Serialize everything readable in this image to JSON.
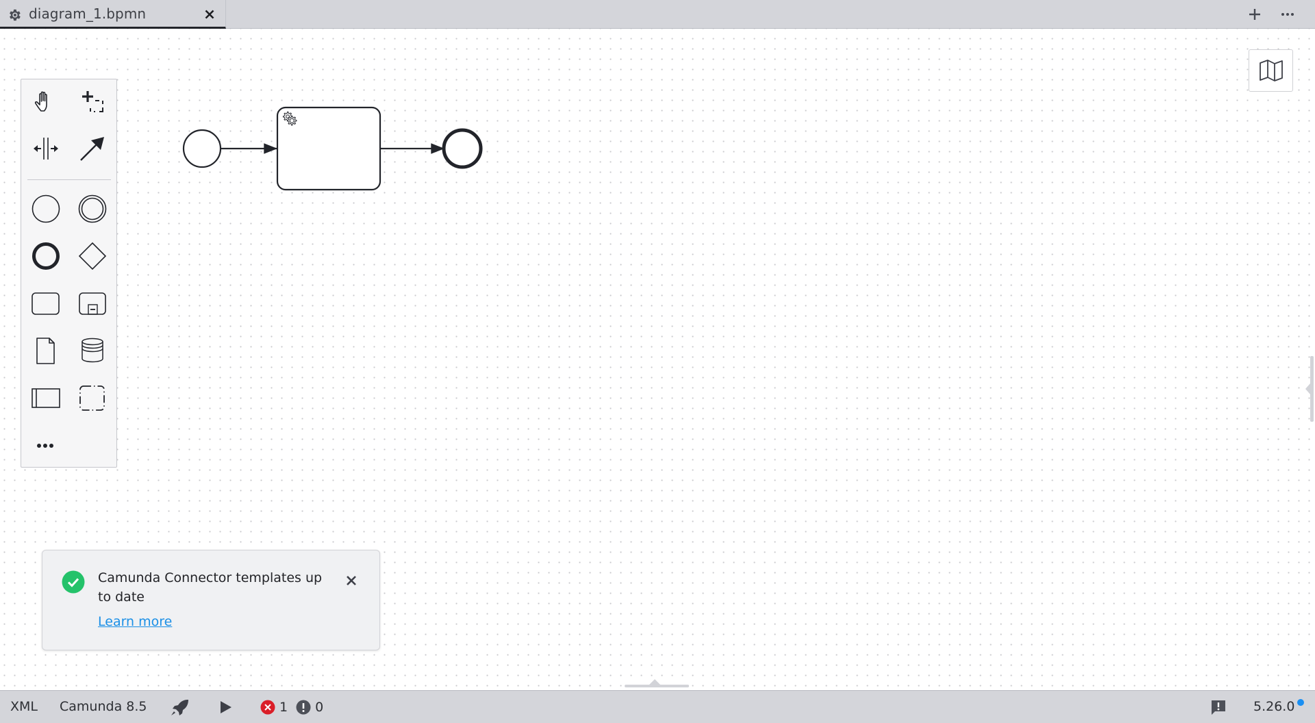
{
  "tabbar": {
    "tabs": [
      {
        "label": "diagram_1.bpmn",
        "icon": "gear-icon",
        "active": true,
        "close_icon": "close-icon"
      }
    ],
    "actions": [
      {
        "name": "new-tab-button",
        "icon": "plus-icon"
      },
      {
        "name": "more-options-button",
        "icon": "ellipsis-icon"
      }
    ]
  },
  "palette": {
    "tools": [
      {
        "name": "hand-tool",
        "icon": "hand-icon",
        "title": "Activate hand tool"
      },
      {
        "name": "lasso-tool",
        "icon": "lasso-icon",
        "title": "Activate lasso tool"
      },
      {
        "name": "space-tool",
        "icon": "space-icon",
        "title": "Activate create/remove space tool"
      },
      {
        "name": "connect-tool",
        "icon": "arrow-icon",
        "title": "Activate global connect tool"
      }
    ],
    "elements": [
      {
        "name": "start-event",
        "icon": "start-event-icon"
      },
      {
        "name": "intermediate-event",
        "icon": "intermediate-event-icon"
      },
      {
        "name": "end-event",
        "icon": "end-event-icon"
      },
      {
        "name": "gateway",
        "icon": "gateway-icon"
      },
      {
        "name": "task",
        "icon": "task-icon"
      },
      {
        "name": "subprocess",
        "icon": "subprocess-icon"
      },
      {
        "name": "data-object",
        "icon": "data-object-icon"
      },
      {
        "name": "data-store",
        "icon": "data-store-icon"
      },
      {
        "name": "pool",
        "icon": "pool-icon"
      },
      {
        "name": "group",
        "icon": "group-icon"
      },
      {
        "name": "more",
        "icon": "more-icon"
      }
    ]
  },
  "diagram": {
    "elements": [
      {
        "type": "startEvent",
        "name": "start-event"
      },
      {
        "type": "sequenceFlow",
        "name": "sequence-flow-1"
      },
      {
        "type": "serviceTask",
        "name": "service-task",
        "label": ""
      },
      {
        "type": "sequenceFlow",
        "name": "sequence-flow-2"
      },
      {
        "type": "endEvent",
        "name": "end-event"
      }
    ]
  },
  "minimap": {
    "icon": "map-icon"
  },
  "notification": {
    "status": "success",
    "title": "Camunda Connector templates up to date",
    "link_label": "Learn more",
    "colors": {
      "success": "#24c26a",
      "link": "#1a8fe6"
    }
  },
  "statusbar": {
    "xml_label": "XML",
    "engine_label": "Camunda 8.5",
    "deploy_icon": "rocket-icon",
    "run_icon": "play-icon",
    "errors": "1",
    "warnings": "0",
    "feedback_icon": "feedback-icon",
    "version": "5.26.0",
    "colors": {
      "error": "#da1e28",
      "warning": "#4d5058",
      "update_dot": "#1a8ff2"
    }
  }
}
